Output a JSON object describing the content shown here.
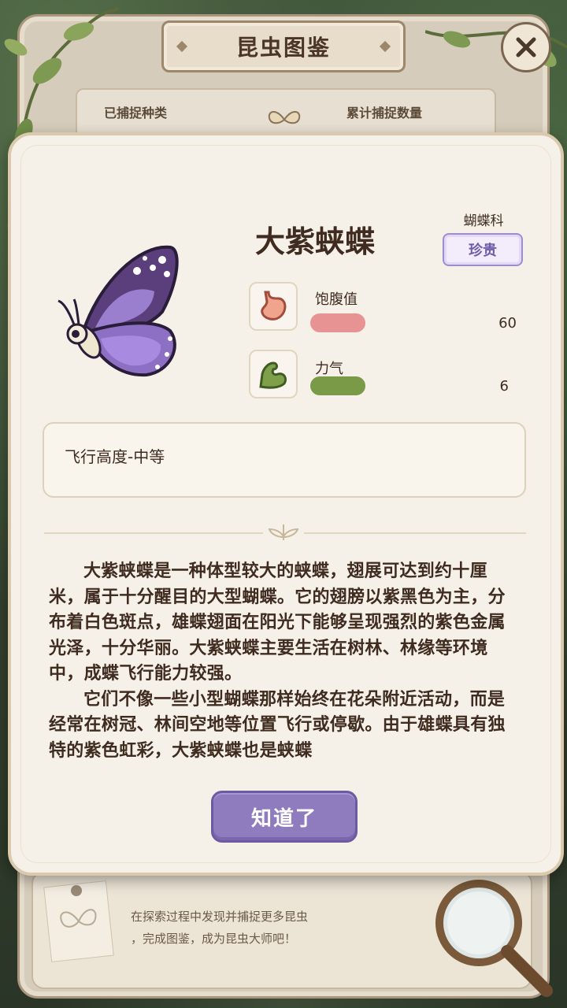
{
  "header": {
    "title": "昆虫图鉴",
    "close_icon": "close-icon"
  },
  "stats": {
    "caught_species_label": "已捕捉种类",
    "total_caught_label": "累计捕捉数量"
  },
  "insect": {
    "name": "大紫蛱蝶",
    "family": "蝴蝶科",
    "rarity": "珍贵",
    "image_icon": "purple-butterfly-icon",
    "attributes": [
      {
        "label": "饱腹值",
        "value": "60",
        "icon": "stomach-icon",
        "color": "#e89393"
      },
      {
        "label": "力气",
        "value": "6",
        "icon": "flexed-arm-icon",
        "color": "#7a9a48"
      }
    ],
    "trait": "飞行高度-中等",
    "description": [
      "大紫蛱蝶是一种体型较大的蛱蝶，翅展可达到约十厘米，属于十分醒目的大型蝴蝶。它的翅膀以紫黑色为主，分布着白色斑点，雄蝶翅面在阳光下能够呈现强烈的紫色金属光泽，十分华丽。大紫蛱蝶主要生活在树林、林缘等环境中，成蝶飞行能力较强。",
      "它们不像一些小型蝴蝶那样始终在花朵附近活动，而是经常在树冠、林间空地等位置飞行或停歇。由于雄蝶具有独特的紫色虹彩，大紫蛱蝶也是蛱蝶"
    ]
  },
  "confirm_button": "知道了",
  "footer": {
    "hint_line1": "在探索过程中发现并捕捉更多昆虫",
    "hint_line2": "，完成图鉴，成为昆虫大师吧！"
  },
  "colors": {
    "accent_purple": "#8f7cbf",
    "panel_bg": "#f6f1e8",
    "text_brown": "#3f2b1f"
  }
}
